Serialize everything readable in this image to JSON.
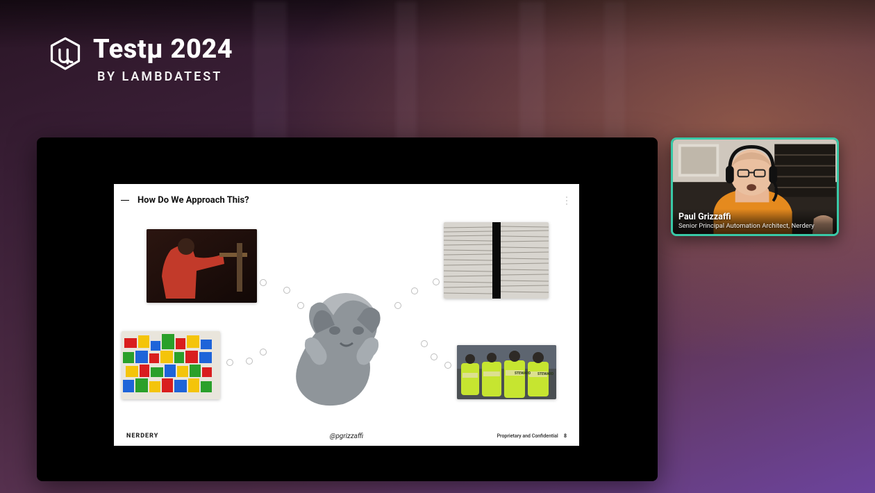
{
  "event": {
    "title": "Testµ 2024",
    "subtitle": "BY LAMBDATEST"
  },
  "slide": {
    "title": "How Do We Approach This?",
    "brand": "NERDERY",
    "handle": "@pgrizzaffi",
    "confidential": "Proprietary and Confidential",
    "page": "8"
  },
  "speaker": {
    "name": "Paul Grizzaffi",
    "title": "Senior Principal Automation Architect, Nerdery"
  }
}
